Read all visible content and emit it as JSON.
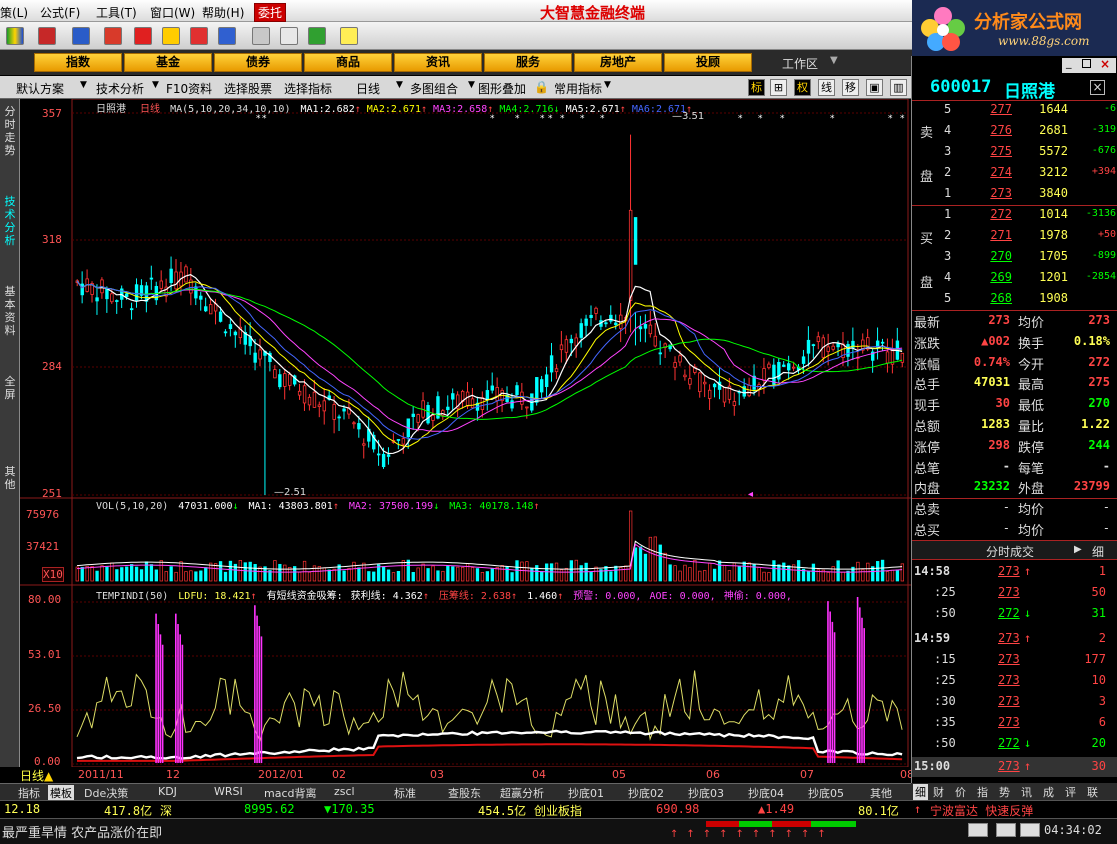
{
  "menu": {
    "items": [
      "策(L)",
      "公式(F)",
      "工具(T)",
      "窗口(W)",
      "帮助(H)"
    ],
    "trust": "委托",
    "title": "大智慧金融终端"
  },
  "logo": {
    "name": "分析家公式网",
    "site": "www.88gs.com"
  },
  "categories": [
    "指数",
    "基金",
    "债券",
    "商品",
    "资讯",
    "服务",
    "房地产",
    "投顾"
  ],
  "work_area": "工作区",
  "chart_toolbar": {
    "left_items": [
      "默认方案",
      "技术分析",
      "F10资料",
      "选择股票",
      "选择指标",
      "日线",
      "多图组合",
      "图形叠加",
      "常用指标"
    ],
    "right_icons": [
      "标",
      "⊞",
      "权",
      "线",
      "移",
      "▣",
      "▥"
    ]
  },
  "left_tabs": [
    "分时走势",
    "技术分析",
    "基本资料",
    "全屏",
    "其他"
  ],
  "main_chart": {
    "stock_name": "日照港",
    "period": "日线",
    "ma_label": "MA(5,10,20,34,10,10)",
    "ma_values": [
      {
        "name": "MA1:",
        "value": "2.682",
        "color": "#ffffff"
      },
      {
        "name": "MA2:",
        "value": "2.671",
        "color": "#ffff00"
      },
      {
        "name": "MA3:",
        "value": "2.658",
        "color": "#ff44ff"
      },
      {
        "name": "MA4:",
        "value": "2.716",
        "color": "#00ff00"
      },
      {
        "name": "MA5:",
        "value": "2.671",
        "color": "#ffffff"
      },
      {
        "name": "MA6:",
        "value": "2.671",
        "color": "#4466ff"
      }
    ],
    "y_ticks": [
      "357",
      "318",
      "284",
      "251"
    ],
    "high_label": "3.51",
    "low_label": "2.51"
  },
  "volume_chart": {
    "label": "VOL(5,10,20)",
    "vol": "47031.000",
    "ma1": "MA1: 43803.801",
    "ma2": "MA2: 37500.199",
    "ma3": "MA3: 40178.148",
    "y_ticks": [
      "75976",
      "37421",
      "X10"
    ]
  },
  "indicator_chart": {
    "label": "TEMPINDI(50)",
    "ldfu": "LDFU: 18.421",
    "short_flow": "有短线资金吸筹:",
    "profit": "获利线: 4.362",
    "press": "压筹线: 2.638",
    "val": "1.460",
    "warn": "预警: 0.000,",
    "aoe": "AOE: 0.000,",
    "shen": "神偷: 0.000,",
    "y_ticks": [
      "80.00",
      "53.01",
      "26.50",
      "0.00"
    ]
  },
  "x_axis": [
    "2011/11",
    "12",
    "2012/01",
    "02",
    "03",
    "04",
    "05",
    "06",
    "07",
    "08"
  ],
  "day_tag": "日线",
  "bottom_tabs": [
    "指标",
    "模板",
    "Dde决策",
    "KDJ",
    "WRSI",
    "macd背离",
    "zscl",
    "标准",
    "查股东",
    "超赢分析",
    "抄底01",
    "抄底02",
    "抄底03",
    "抄底04",
    "抄底05",
    "其他"
  ],
  "quote": {
    "code": "600017",
    "name": "日照港",
    "sell": [
      {
        "level": "5",
        "price": "277",
        "vol": "1644",
        "chg": "-6"
      },
      {
        "level": "4",
        "price": "276",
        "vol": "2681",
        "chg": "-319"
      },
      {
        "level": "3",
        "price": "275",
        "vol": "5572",
        "chg": "-676"
      },
      {
        "level": "2",
        "price": "274",
        "vol": "3212",
        "chg": "+394"
      },
      {
        "level": "1",
        "price": "273",
        "vol": "3840",
        "chg": ""
      }
    ],
    "buy": [
      {
        "level": "1",
        "price": "272",
        "vol": "1014",
        "chg": "-3136"
      },
      {
        "level": "2",
        "price": "271",
        "vol": "1978",
        "chg": "+50"
      },
      {
        "level": "3",
        "price": "270",
        "vol": "1705",
        "chg": "-899"
      },
      {
        "level": "4",
        "price": "269",
        "vol": "1201",
        "chg": "-2854"
      },
      {
        "level": "5",
        "price": "268",
        "vol": "1908",
        "chg": ""
      }
    ],
    "sell_label": [
      "卖",
      "盘"
    ],
    "buy_label": [
      "买",
      "盘"
    ],
    "stats": [
      {
        "l1": "最新",
        "v1": "273",
        "c1": "#ff4444",
        "l2": "均价",
        "v2": "273",
        "c2": "#ff4444"
      },
      {
        "l1": "涨跌",
        "v1": "▲002",
        "c1": "#ff4444",
        "l2": "换手",
        "v2": "0.18%",
        "c2": "#ffff55"
      },
      {
        "l1": "涨幅",
        "v1": "0.74%",
        "c1": "#ff4444",
        "l2": "今开",
        "v2": "272",
        "c2": "#ff4444"
      },
      {
        "l1": "总手",
        "v1": "47031",
        "c1": "#ffff55",
        "l2": "最高",
        "v2": "275",
        "c2": "#ff4444"
      },
      {
        "l1": "现手",
        "v1": "30",
        "c1": "#ff4444",
        "l2": "最低",
        "v2": "270",
        "c2": "#00ff00"
      },
      {
        "l1": "总额",
        "v1": "1283",
        "c1": "#ffff55",
        "l2": "量比",
        "v2": "1.22",
        "c2": "#ffff55"
      },
      {
        "l1": "涨停",
        "v1": "298",
        "c1": "#ff4444",
        "l2": "跌停",
        "v2": "244",
        "c2": "#00ff00"
      },
      {
        "l1": "总笔",
        "v1": "-",
        "c1": "#dddddd",
        "l2": "每笔",
        "v2": "-",
        "c2": "#dddddd"
      },
      {
        "l1": "内盘",
        "v1": "23232",
        "c1": "#00ff00",
        "l2": "外盘",
        "v2": "23799",
        "c2": "#ff4444"
      }
    ],
    "extra": [
      {
        "l1": "总卖",
        "v1": "-",
        "l2": "均价",
        "v2": "-"
      },
      {
        "l1": "总买",
        "v1": "-",
        "l2": "均价",
        "v2": "-"
      }
    ],
    "ticks_title": "分时成交",
    "ticks_btn": "细",
    "ticks": [
      {
        "time": "14:58",
        "price": "273",
        "dir": "up",
        "vol": "1"
      },
      {
        "time": ":25",
        "price": "273",
        "dir": "",
        "vol": "50"
      },
      {
        "time": ":50",
        "price": "272",
        "dir": "down",
        "vol": "31"
      },
      {
        "time": "14:59",
        "price": "273",
        "dir": "up",
        "vol": "2"
      },
      {
        "time": ":15",
        "price": "273",
        "dir": "",
        "vol": "177"
      },
      {
        "time": ":25",
        "price": "273",
        "dir": "",
        "vol": "10"
      },
      {
        "time": ":30",
        "price": "273",
        "dir": "",
        "vol": "3"
      },
      {
        "time": ":35",
        "price": "273",
        "dir": "",
        "vol": "6"
      },
      {
        "time": ":50",
        "price": "272",
        "dir": "down",
        "vol": "20"
      },
      {
        "time": "15:00",
        "price": "273",
        "dir": "up",
        "vol": "30"
      }
    ]
  },
  "right_tabs": [
    "细",
    "财",
    "价",
    "指",
    "势",
    "讯",
    "成",
    "评",
    "联"
  ],
  "index_bar": {
    "v1": "12.18",
    "amt1": "417.8亿",
    "name1": "深",
    "v2": "8995.62",
    "chg2": "▼170.35",
    "amt2": "454.5亿",
    "name2": "创业板指",
    "v3": "690.98",
    "chg3": "▲1.49",
    "amt3": "80.1亿",
    "news": "宁波富达 快速反弹"
  },
  "status": {
    "news": "最严重旱情 农产品涨价在即",
    "time": "04:34:02"
  }
}
